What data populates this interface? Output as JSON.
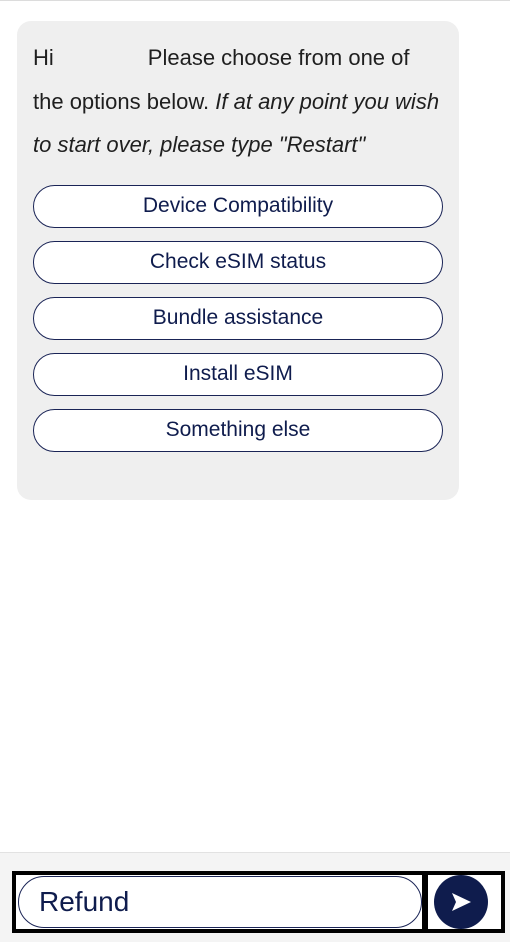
{
  "chat": {
    "greeting_prefix": "Hi",
    "message_main": "Please choose from one of the options below.",
    "message_italic": "If at any point you wish to start over, please type \"Restart\"",
    "options": [
      {
        "label": "Device Compatibility"
      },
      {
        "label": "Check eSIM status"
      },
      {
        "label": "Bundle assistance"
      },
      {
        "label": "Install eSIM"
      },
      {
        "label": "Something else"
      }
    ]
  },
  "composer": {
    "input_value": "Refund",
    "send_icon": "send-arrow-icon"
  },
  "colors": {
    "accent": "#0f1c4d",
    "bubble_bg": "#efefef"
  }
}
